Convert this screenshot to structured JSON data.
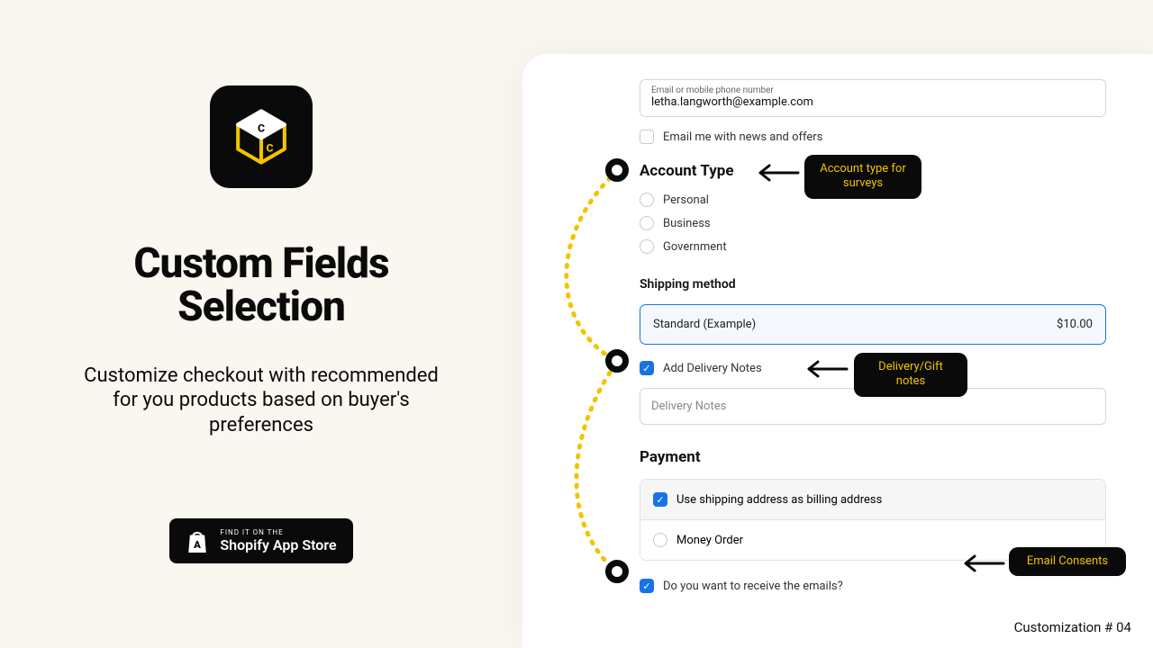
{
  "left": {
    "headline_l1": "Custom Fields",
    "headline_l2": "Selection",
    "subhead": "Customize checkout with recommended for you products based on buyer's preferences",
    "badge_small": "FIND IT ON THE",
    "badge_big": "Shopify App Store"
  },
  "contact": {
    "label": "Email or mobile phone number",
    "value": "letha.langworth@example.com",
    "newsletter_label": "Email me with news and offers"
  },
  "account": {
    "title": "Account Type",
    "opts": [
      "Personal",
      "Business",
      "Government"
    ]
  },
  "shipping": {
    "title": "Shipping method",
    "method": "Standard (Example)",
    "price": "$10.00",
    "add_notes_label": "Add Delivery Notes",
    "notes_placeholder": "Delivery Notes"
  },
  "payment": {
    "title": "Payment",
    "use_shipping_label": "Use shipping address as billing address",
    "method": "Money Order",
    "emails_label": "Do you want to receive the emails?"
  },
  "callouts": {
    "c1": "Account type for surveys",
    "c2": "Delivery/Gift notes",
    "c3": "Email Consents"
  },
  "footer": "Customization # 04"
}
